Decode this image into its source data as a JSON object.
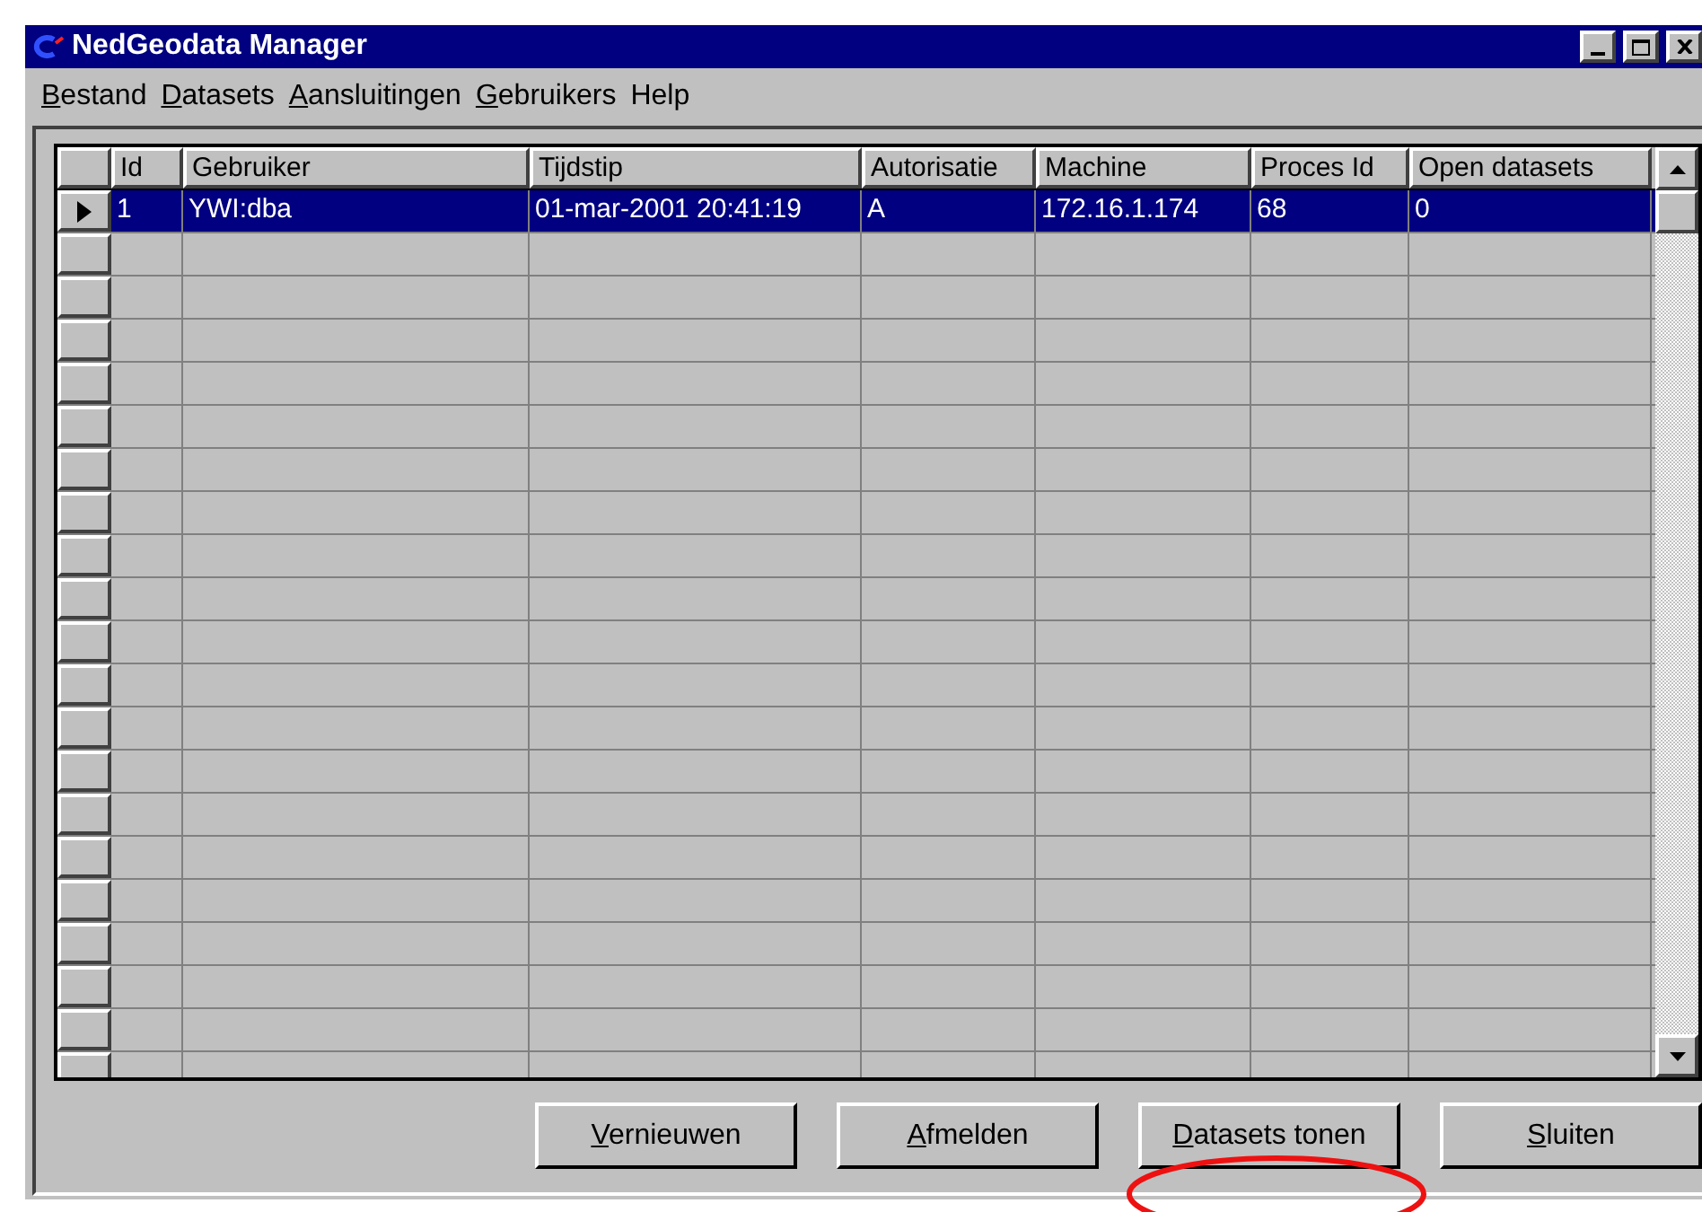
{
  "window": {
    "title": "NedGeodata Manager"
  },
  "menu": [
    {
      "key": "B",
      "rest": "estand"
    },
    {
      "key": "D",
      "rest": "atasets"
    },
    {
      "key": "A",
      "rest": "ansluitingen"
    },
    {
      "key": "G",
      "rest": "ebruikers"
    },
    {
      "label": "Help"
    }
  ],
  "table": {
    "columns": [
      "Id",
      "Gebruiker",
      "Tijdstip",
      "Autorisatie",
      "Machine",
      "Proces Id",
      "Open datasets"
    ],
    "rows": [
      {
        "selected": true,
        "cells": [
          "1",
          "YWI:dba",
          "01-mar-2001 20:41:19",
          "A",
          "172.16.1.174",
          "68",
          "0"
        ]
      }
    ]
  },
  "buttons": [
    {
      "key": "V",
      "rest": "ernieuwen"
    },
    {
      "key": "A",
      "rest": "fmelden"
    },
    {
      "key": "D",
      "rest": "atasets tonen",
      "annotated": true
    },
    {
      "key": "S",
      "rest": "luiten"
    }
  ]
}
